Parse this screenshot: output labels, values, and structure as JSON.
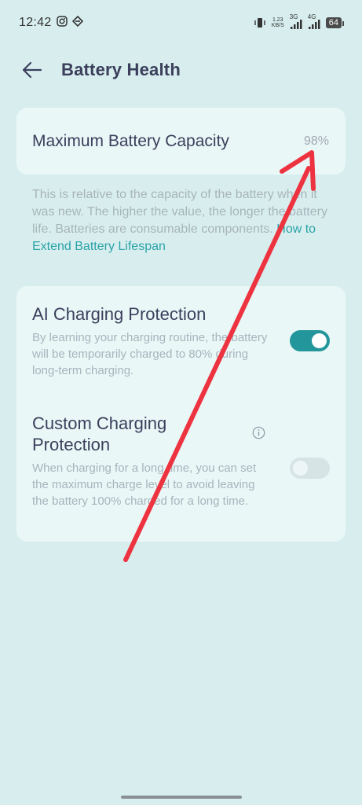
{
  "status_bar": {
    "time": "12:42",
    "net_speed_value": "1.23",
    "net_speed_unit": "KB/S",
    "network_label_1": "3G",
    "network_label_2": "4G",
    "battery_level": "64"
  },
  "header": {
    "title": "Battery Health"
  },
  "capacity": {
    "label": "Maximum Battery Capacity",
    "value": "98%"
  },
  "description": {
    "text": "This is relative to the capacity of the battery when it was new. The higher the value, the longer the battery life. Batteries are consumable components. ",
    "link": "How to Extend Battery Lifespan"
  },
  "ai_protection": {
    "title": "AI Charging Protection",
    "description": "By learning your charging routine, the battery will be temporarily charged to 80% during long-term charging.",
    "enabled": true
  },
  "custom_protection": {
    "title": "Custom Charging Protection",
    "description": "When charging for a long time, you can set the maximum charge level to avoid leaving the battery 100% charged for a long time.",
    "enabled": false
  },
  "colors": {
    "background": "#d8eeee",
    "card": "#e9f7f7",
    "accent": "#23969b",
    "link": "#2aa3a8",
    "annotation": "#ee3340"
  },
  "icons": {
    "back": "arrow-left-icon",
    "info": "info-icon",
    "annotation": "red-arrow-icon"
  }
}
